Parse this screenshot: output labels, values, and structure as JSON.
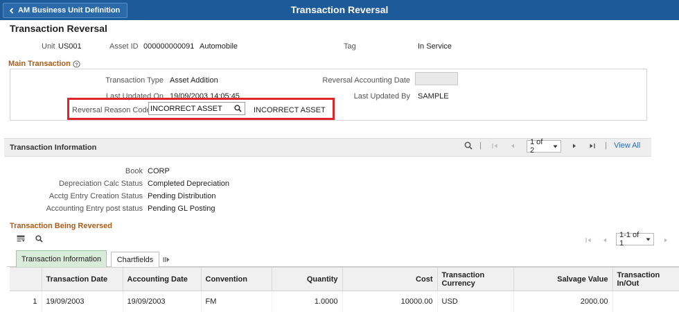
{
  "banner": {
    "back_label": "AM Business Unit Definition",
    "title": "Transaction Reversal"
  },
  "page_title": "Transaction Reversal",
  "header": {
    "unit_label": "Unit",
    "unit_value": "US001",
    "asset_id_label": "Asset ID",
    "asset_id_value": "000000000091",
    "asset_desc": "Automobile",
    "tag_label": "Tag",
    "status_value": "In Service"
  },
  "main_transaction": {
    "title": "Main Transaction",
    "transaction_type_label": "Transaction Type",
    "transaction_type_value": "Asset Addition",
    "reversal_acctg_date_label": "Reversal Accounting Date",
    "reversal_acctg_date_value": "",
    "last_updated_on_label": "Last Updated On",
    "last_updated_on_value": "19/09/2003 14:05:45",
    "last_updated_by_label": "Last Updated By",
    "last_updated_by_value": "SAMPLE",
    "reason_code_label": "Reversal Reason Code",
    "reason_code_value": "INCORRECT ASSET",
    "reason_code_desc": "INCORRECT ASSET"
  },
  "transaction_info": {
    "title": "Transaction Information",
    "pager_value": "1 of 2",
    "view_all": "View All",
    "book_label": "Book",
    "book_value": "CORP",
    "depr_label": "Depreciation Calc Status",
    "depr_value": "Completed Depreciation",
    "acctg_creation_label": "Acctg Entry Creation Status",
    "acctg_creation_value": "Pending Distribution",
    "acctg_post_label": "Accounting Entry post status",
    "acctg_post_value": "Pending GL Posting"
  },
  "reversed": {
    "title": "Transaction Being Reversed",
    "pager_value": "1-1 of 1",
    "tabs": [
      {
        "label": "Transaction Information"
      },
      {
        "label": "Chartfields"
      }
    ],
    "columns": [
      "Transaction Date",
      "Accounting Date",
      "Convention",
      "Quantity",
      "Cost",
      "Transaction Currency",
      "Salvage Value",
      "Transaction In/Out"
    ],
    "rows": [
      {
        "num": "1",
        "transaction_date": "19/09/2003",
        "accounting_date": "19/09/2003",
        "convention": "FM",
        "quantity": "1.0000",
        "cost": "10000.00",
        "currency": "USD",
        "salvage": "2000.00",
        "in_out": ""
      }
    ]
  },
  "colors": {
    "banner": "#1d5a9a",
    "section_title": "#b05a16",
    "highlight": "#e0252a",
    "link": "#2b6bb5"
  }
}
